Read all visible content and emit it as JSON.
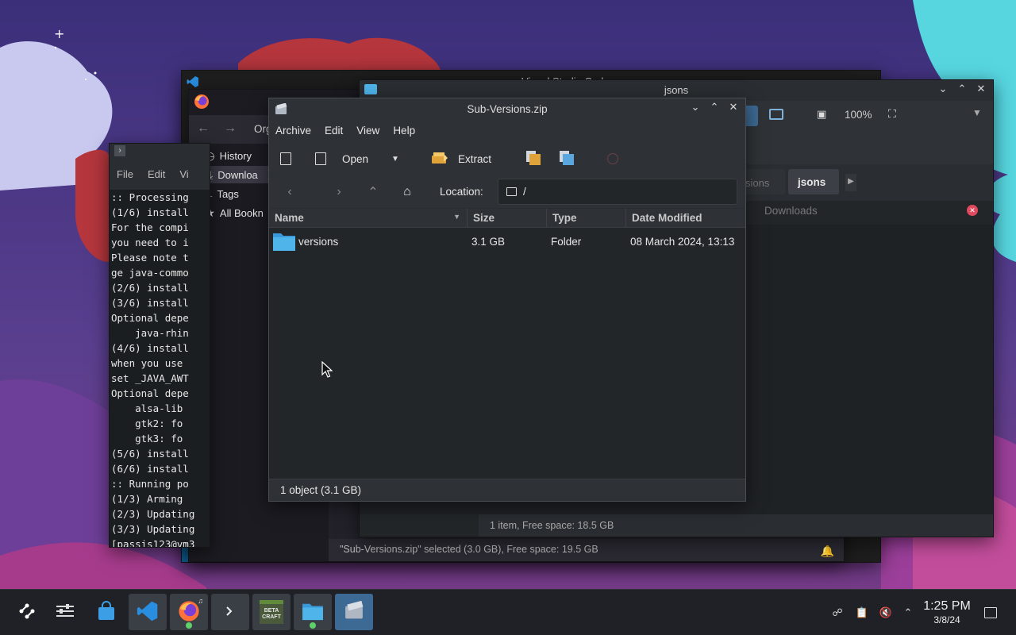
{
  "vscode": {
    "title": "everyone… — Visual Studio Code"
  },
  "firefox": {
    "org_label": "Org",
    "sidebar": {
      "items": [
        {
          "label": "History"
        },
        {
          "label": "Downloa"
        },
        {
          "label": "Tags"
        },
        {
          "label": "All Bookn"
        }
      ]
    },
    "status_text": "\"Sub-Versions.zip\" selected (3.0 GB), Free space: 19.5 GB"
  },
  "konsole": {
    "menu": [
      "File",
      "Edit",
      "Vi"
    ],
    "lines": [
      ":: Processing",
      "(1/6) install",
      "For the compi",
      "you need to i",
      "Please note t",
      "ge java-commo",
      "(2/6) install",
      "(3/6) install",
      "Optional depe",
      "    java-rhin",
      "(4/6) install",
      "when you use",
      "set _JAVA_AWT",
      "Optional depe",
      "    alsa-lib",
      "    gtk2: fo",
      "    gtk3: fo",
      "(5/6) install",
      "(6/6) install",
      ":: Running po",
      "(1/3) Arming",
      "(2/3) Updating",
      "(3/3) Updating",
      "[passis123@vm3"
    ]
  },
  "dolphin": {
    "title": "jsons",
    "zoom": "100%",
    "tabs": [
      "sions",
      "jsons"
    ],
    "places_label": "Downloads",
    "status_text": "1 item, Free space: 18.5 GB"
  },
  "ark": {
    "title": "Sub-Versions.zip",
    "menu": [
      "Archive",
      "Edit",
      "View",
      "Help"
    ],
    "toolbar": {
      "open_label": "Open",
      "extract_label": "Extract"
    },
    "location_label": "Location:",
    "location_value": "/",
    "columns": [
      "Name",
      "Size",
      "Type",
      "Date Modified"
    ],
    "rows": [
      {
        "name": "versions",
        "size": "3.1 GB",
        "type": "Folder",
        "modified": "08 March 2024, 13:13"
      }
    ],
    "status_text": "1 object (3.1 GB)"
  },
  "taskbar": {
    "time": "1:25 PM",
    "date": "3/8/24",
    "beta_craft_label": "BETA CRAFT"
  },
  "colors": {
    "accent": "#3d6a94",
    "folder": "#4fb4ea",
    "close_red": "#e04a5f"
  }
}
